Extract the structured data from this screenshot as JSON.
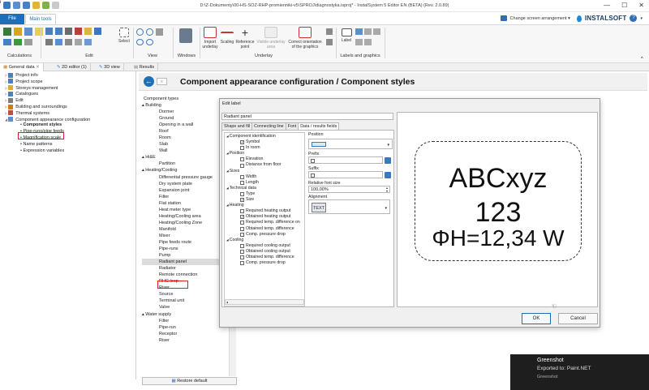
{
  "window": {
    "title": "D:\\Z-Dokumenty\\00-HS-SOZ-RHP-promienniki-v5\\SPROJ\\diagnostyka.isproj* - InstalSystem 5 Editor EN (BETA) (Rev. 2.0.89)",
    "min": "—",
    "max": "☐",
    "close": "✕"
  },
  "ribbon_tabs": {
    "file": "File",
    "main": "Main tools"
  },
  "top_right": {
    "change_arrangement": "Change screen arrangement ▾",
    "brand": "INSTALSOFT",
    "help": "?"
  },
  "ribbon_groups": {
    "calculations": "Calculations",
    "edit": "Edit",
    "select": "Select",
    "view": "View",
    "windows": "Windows",
    "underlay": "Underlay",
    "labels": "Labels and graphics",
    "import_underlay": "Import underlay",
    "scaling": "Scaling",
    "reference_point": "Reference point",
    "visible_underlay_area": "Visible underlay area",
    "correct_orientation": "Correct orientation of the graphics",
    "label": "Label"
  },
  "doc_tabs": [
    "General data",
    "2D editor (1)",
    "3D view",
    "Results"
  ],
  "project_tree": [
    {
      "label": "Project info",
      "level": 0
    },
    {
      "label": "Project scope",
      "level": 0
    },
    {
      "label": "Storeys management",
      "level": 0
    },
    {
      "label": "Catalogues",
      "level": 0
    },
    {
      "label": "Edit",
      "level": 0
    },
    {
      "label": "Building and surroundings",
      "level": 0
    },
    {
      "label": "Thermal systems",
      "level": 0
    },
    {
      "label": "Component appearance configuration",
      "level": 0
    },
    {
      "label": "Component styles",
      "level": 1
    },
    {
      "label": "Pipe-runs/pipe feeds",
      "level": 1
    },
    {
      "label": "Magnification scale",
      "level": 1
    },
    {
      "label": "Name patterns",
      "level": 1
    },
    {
      "label": "Expression variables",
      "level": 1
    }
  ],
  "page": {
    "title": "Component appearance configuration / Component styles",
    "back": "←",
    "fwd": "≡"
  },
  "component_types": {
    "header": "Component types",
    "items": [
      "▴ Building",
      "Dormer",
      "Ground",
      "Opening in a wall",
      "Roof",
      "Room",
      "Slab",
      "Wall",
      "▴ Hi&E",
      "Partition",
      "▴ Heating/Cooling",
      "Differential pressure gauge",
      "Dry system plate",
      "Expansion joint",
      "Filter",
      "Flat station",
      "Heat meter type",
      "Heating/Cooling area",
      "Heating/Cooling Zone",
      "Manifold",
      "Mixer",
      "Pipe feeds route",
      "Pipe-runs",
      "Pump",
      "Radiant panel",
      "Radiator",
      "Remote connection",
      "RHC loop",
      "Riser",
      "Source",
      "Terminal unit",
      "Valve",
      "▴ Water supply",
      "Filter",
      "Pipe-run",
      "Receptor",
      "Riser"
    ],
    "restore": "Restore default"
  },
  "dialog": {
    "title": "Edit label",
    "name_value": "Radiant panel",
    "tabs": [
      "Shape and fill",
      "Connecting line",
      "Font",
      "Data / results fields"
    ],
    "fields": [
      {
        "label": "Component identification",
        "type": "group"
      },
      {
        "label": "Symbol",
        "checked": true
      },
      {
        "label": "In room",
        "checked": false
      },
      {
        "label": "Position",
        "type": "group"
      },
      {
        "label": "Elevation",
        "checked": false
      },
      {
        "label": "Distance from floor",
        "checked": false
      },
      {
        "label": "Sizes",
        "type": "group"
      },
      {
        "label": "Width",
        "checked": false
      },
      {
        "label": "Length",
        "checked": false
      },
      {
        "label": "Technical data",
        "type": "group"
      },
      {
        "label": "Type",
        "checked": false
      },
      {
        "label": "Size",
        "checked": true
      },
      {
        "label": "Heating",
        "type": "group"
      },
      {
        "label": "Required heating output",
        "checked": false
      },
      {
        "label": "Obtained heating output",
        "checked": true
      },
      {
        "label": "Required temp. difference on",
        "checked": false
      },
      {
        "label": "Obtained temp. difference",
        "checked": false
      },
      {
        "label": "Comp. pressure drop",
        "checked": false
      },
      {
        "label": "Cooling",
        "type": "group"
      },
      {
        "label": "Required cooling output",
        "checked": false
      },
      {
        "label": "Obtained cooling output",
        "checked": false
      },
      {
        "label": "Obtained temp. difference",
        "checked": false
      },
      {
        "label": "Comp. pressure drop",
        "checked": false
      }
    ],
    "props": {
      "position_label": "Position",
      "prefix_label": "Prefix",
      "suffix_label": "Suffix",
      "font_size_label": "Relative font size",
      "font_size_value": "100,00%",
      "alignment_label": "Alignment",
      "alignment_value": "TEXT"
    },
    "preview": {
      "line1": "ABCxyz",
      "line2": "123",
      "line3": "ΦH=12,34 W"
    },
    "ok": "OK",
    "cancel": "Cancel"
  },
  "toast": {
    "title": "Greenshot",
    "message": "Exported to: Paint.NET",
    "source": "Greenshot"
  }
}
